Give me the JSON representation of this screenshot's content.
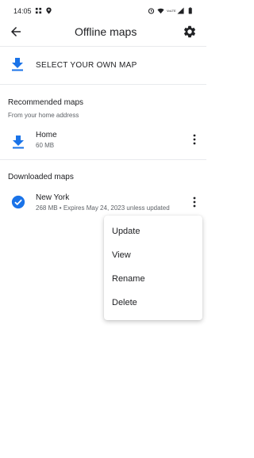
{
  "status_bar": {
    "time": "14:05",
    "icons_left": [
      "grid-notification-icon",
      "location-icon"
    ],
    "icons_right": [
      "alarm-icon",
      "wifi-icon",
      "volte-icon",
      "signal-icon",
      "battery-icon"
    ],
    "network_text": "VoLTE"
  },
  "app_bar": {
    "title": "Offline maps",
    "back_icon": "back-arrow-icon",
    "settings_icon": "gear-icon"
  },
  "select_own_map": {
    "label": "SELECT YOUR OWN MAP",
    "icon": "download-icon"
  },
  "recommended": {
    "heading": "Recommended maps",
    "subheading": "From your home address",
    "items": [
      {
        "name": "Home",
        "size": "60 MB",
        "icon": "download-icon"
      }
    ]
  },
  "downloaded": {
    "heading": "Downloaded maps",
    "items": [
      {
        "name": "New York",
        "details": "268 MB • Expires May 24, 2023 unless updated",
        "icon": "check-circle-icon"
      }
    ]
  },
  "menu": {
    "items": [
      "Update",
      "View",
      "Rename",
      "Delete"
    ]
  },
  "colors": {
    "accent": "#1a73e8",
    "text_primary": "#202124",
    "text_secondary": "#5f6368",
    "divider": "#e8eaed"
  }
}
